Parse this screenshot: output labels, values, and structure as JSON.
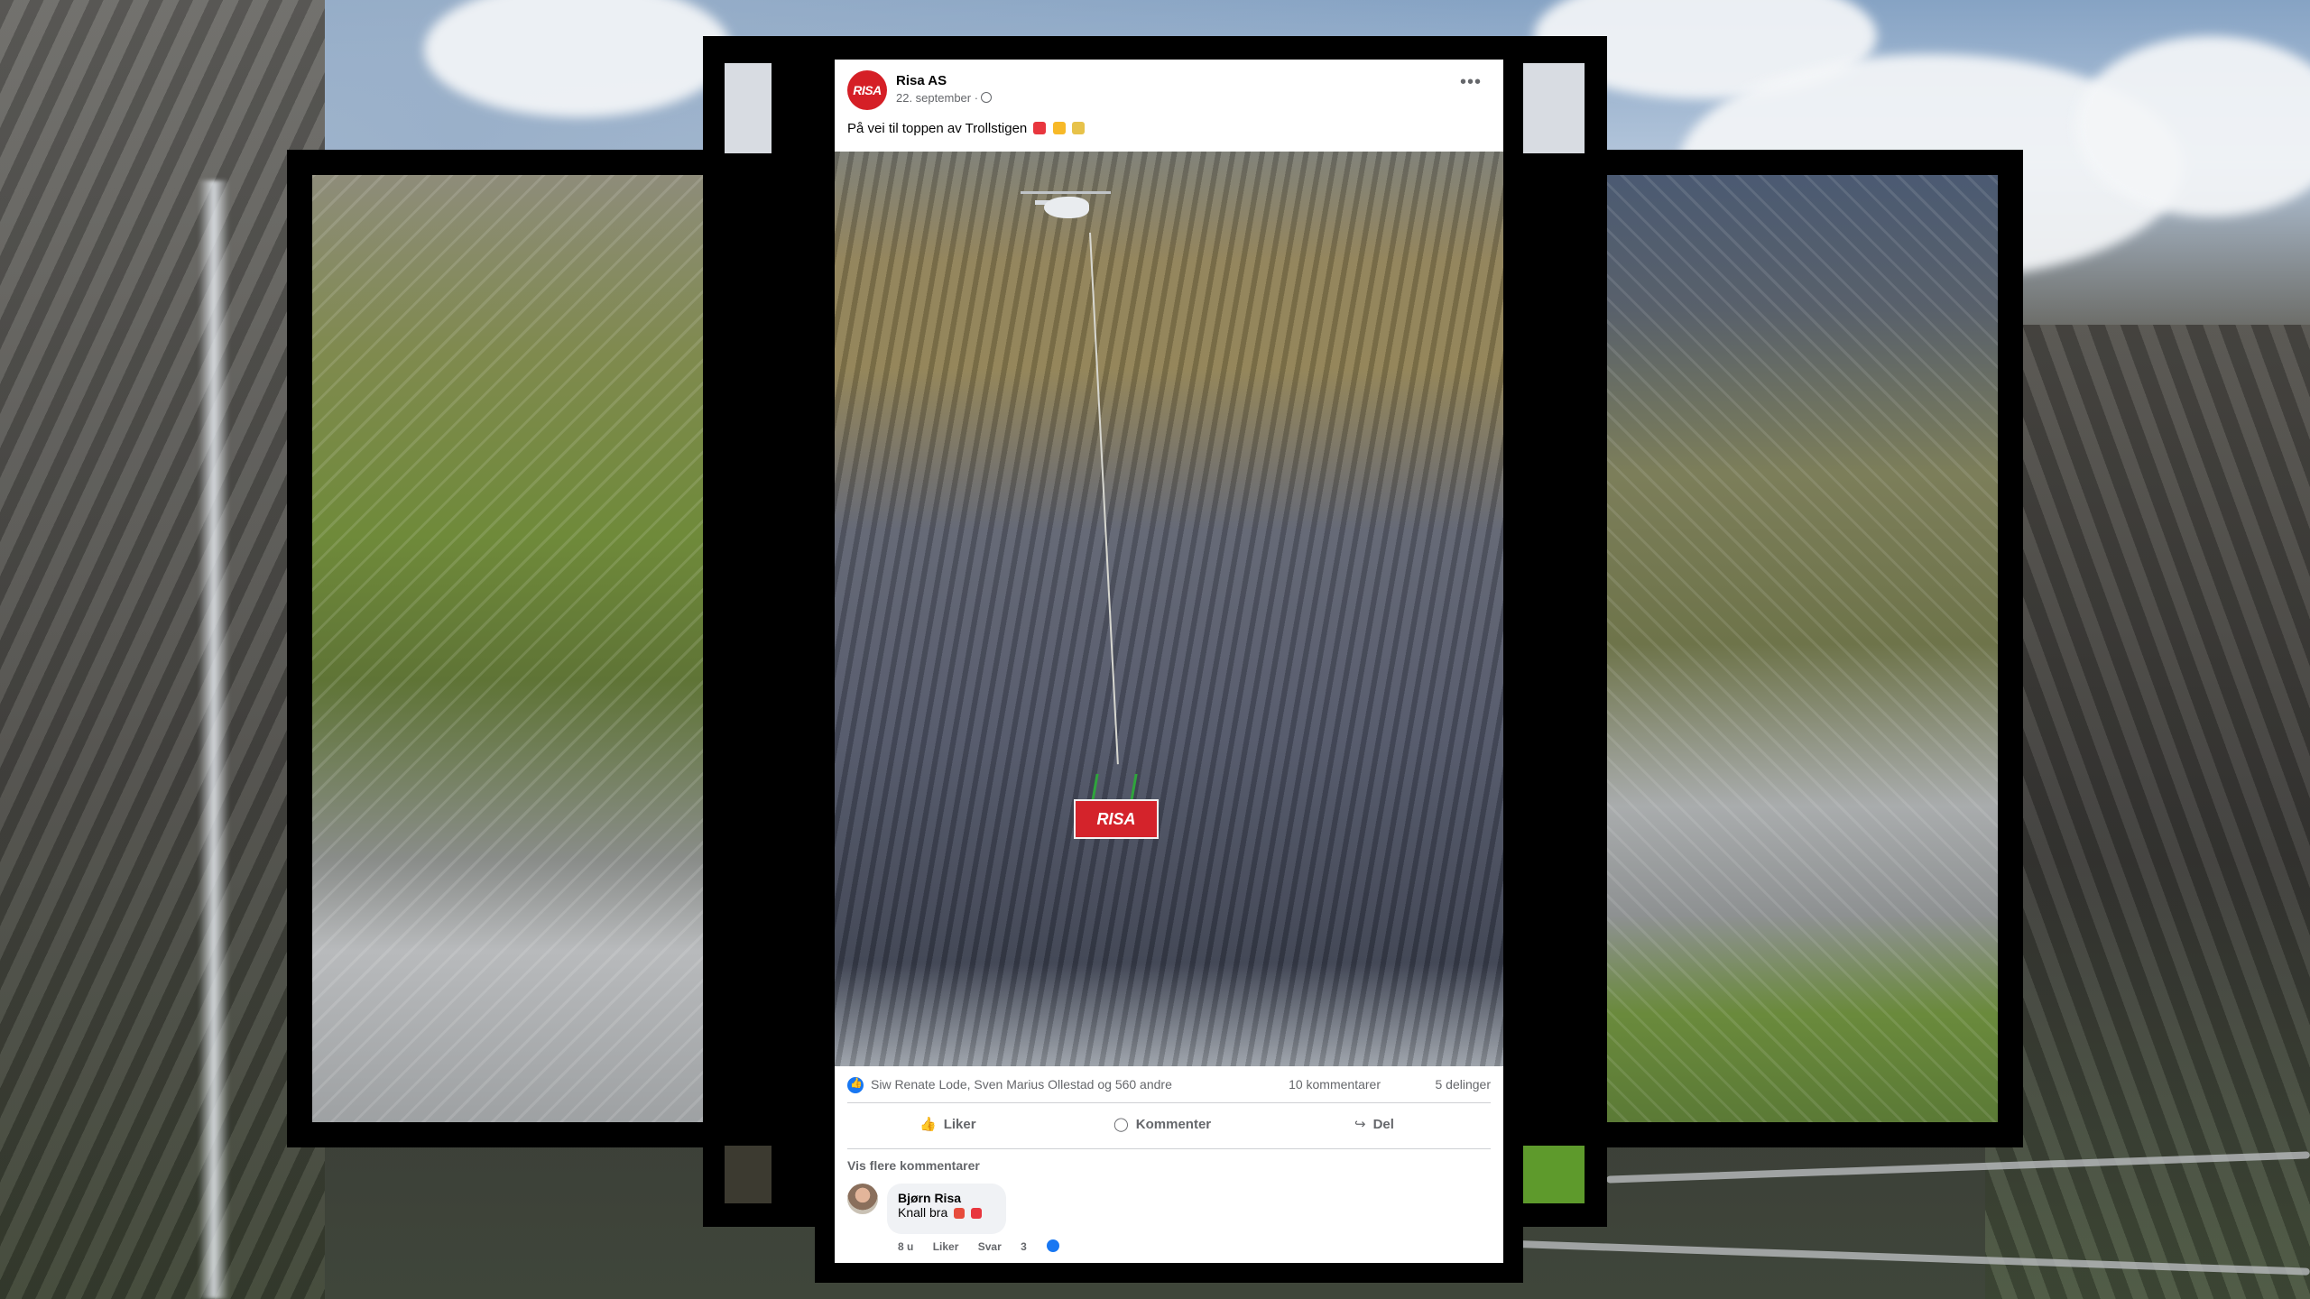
{
  "post": {
    "page_name": "Risa AS",
    "avatar_text": "RISA",
    "date": "22. september ·",
    "caption": "På vei til toppen av Trollstigen",
    "cargo_label": "RISA",
    "reactors": "Siw Renate Lode, Sven Marius Ollestad og 560 andre",
    "comments_count": "10 kommentarer",
    "shares_count": "5 delinger",
    "actions": {
      "like": "Liker",
      "comment": "Kommenter",
      "share": "Del"
    },
    "more_comments": "Vis flere kommentarer",
    "comment": {
      "author": "Bjørn Risa",
      "text": "Knall bra",
      "time": "8 u",
      "like": "Liker",
      "reply": "Svar",
      "reaction_count": "3"
    }
  },
  "colors": {
    "brand_red": "#d51f26",
    "facebook_blue": "#1877f2",
    "frame": "#000000"
  },
  "icons": [
    "globe-icon",
    "more-options-icon",
    "like-reaction-icon",
    "thumbs-up-icon",
    "comment-icon",
    "share-icon"
  ]
}
